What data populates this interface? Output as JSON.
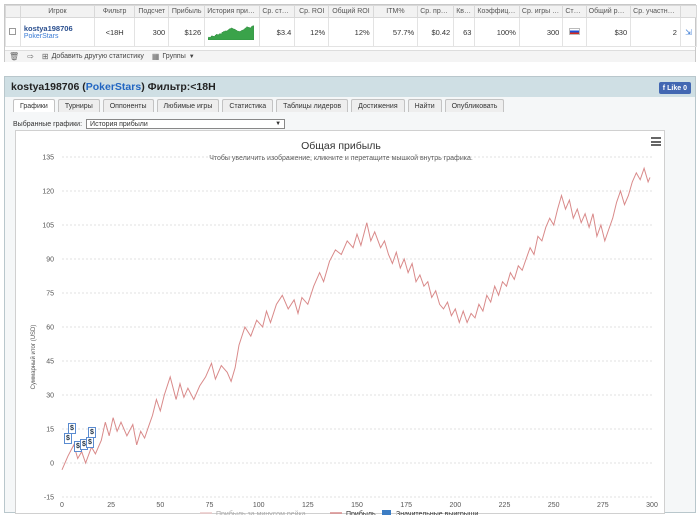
{
  "stats_table": {
    "headers": [
      "",
      "Игрок",
      "Фильтр",
      "Подсчет",
      "Прибыль",
      "История прибыли",
      "Ср. ставка",
      "Ср. ROI",
      "Общий ROI",
      "ITM%",
      "Ср. прибыль",
      "Квалиф.",
      "Коэффициент",
      "Ср. игры / день",
      "Страна",
      "Общий рейк",
      "Ср. участники",
      ""
    ],
    "row": {
      "player_name": "kostya198706",
      "site": "PokerStars",
      "filter": "<18H",
      "count": "300",
      "profit": "$126",
      "avg_stake": "$3.4",
      "avg_roi": "12%",
      "total_roi": "12%",
      "itm": "57.7%",
      "avg_profit": "$0.42",
      "qualif": "63",
      "coefficient": "100%",
      "avg_games": "300",
      "country": "RU",
      "total_rake": "$30",
      "avg_participants": "2"
    },
    "toolbar": {
      "add_stats_label": "Добавить другую статистику",
      "groups_label": "Группы"
    }
  },
  "player_panel": {
    "player_name": "kostya198706",
    "site": "PokerStars",
    "filter_label": "Фильтр:<18H",
    "like_label": "Like 0",
    "tabs": [
      "Графики",
      "Турниры",
      "Оппоненты",
      "Любимые игры",
      "Статистика",
      "Таблицы лидеров",
      "Достижения",
      "Найти",
      "Опубликовать"
    ],
    "active_tab": 0,
    "selected_graphs_label": "Выбранные графики:",
    "selected_graph_value": "История прибыли"
  },
  "chart_data": {
    "type": "line",
    "title": "Общая прибыль",
    "subtitle": "Чтобы увеличить изображение, кликните и перетащите мышкой внутрь графика.",
    "ylabel": "Суммарный итог (USD)",
    "xlim": [
      0,
      300
    ],
    "ylim": [
      -15,
      135
    ],
    "x_ticks": [
      0,
      25,
      50,
      75,
      100,
      125,
      150,
      175,
      200,
      225,
      250,
      275,
      300
    ],
    "y_ticks": [
      -15,
      0,
      15,
      30,
      45,
      60,
      75,
      90,
      105,
      120,
      135
    ],
    "grid": true,
    "series": [
      {
        "name": "Прибыль",
        "color": "#d98a8a",
        "points": [
          [
            0,
            -3
          ],
          [
            3,
            3
          ],
          [
            6,
            8
          ],
          [
            8,
            2
          ],
          [
            10,
            5
          ],
          [
            12,
            0
          ],
          [
            15,
            7
          ],
          [
            17,
            4
          ],
          [
            20,
            10
          ],
          [
            22,
            18
          ],
          [
            24,
            12
          ],
          [
            26,
            20
          ],
          [
            28,
            14
          ],
          [
            30,
            18
          ],
          [
            33,
            12
          ],
          [
            36,
            17
          ],
          [
            38,
            8
          ],
          [
            40,
            14
          ],
          [
            42,
            11
          ],
          [
            44,
            16
          ],
          [
            46,
            21
          ],
          [
            48,
            28
          ],
          [
            50,
            23
          ],
          [
            52,
            30
          ],
          [
            55,
            38
          ],
          [
            58,
            28
          ],
          [
            60,
            35
          ],
          [
            62,
            29
          ],
          [
            64,
            33
          ],
          [
            67,
            28
          ],
          [
            70,
            34
          ],
          [
            73,
            38
          ],
          [
            76,
            44
          ],
          [
            78,
            37
          ],
          [
            81,
            43
          ],
          [
            84,
            40
          ],
          [
            86,
            36
          ],
          [
            88,
            42
          ],
          [
            90,
            52
          ],
          [
            93,
            60
          ],
          [
            96,
            56
          ],
          [
            99,
            63
          ],
          [
            102,
            60
          ],
          [
            104,
            67
          ],
          [
            106,
            62
          ],
          [
            109,
            70
          ],
          [
            112,
            74
          ],
          [
            115,
            68
          ],
          [
            118,
            72
          ],
          [
            120,
            66
          ],
          [
            122,
            73
          ],
          [
            125,
            70
          ],
          [
            128,
            78
          ],
          [
            131,
            84
          ],
          [
            133,
            80
          ],
          [
            136,
            89
          ],
          [
            139,
            94
          ],
          [
            142,
            92
          ],
          [
            145,
            98
          ],
          [
            148,
            95
          ],
          [
            150,
            101
          ],
          [
            152,
            96
          ],
          [
            155,
            106
          ],
          [
            157,
            98
          ],
          [
            159,
            102
          ],
          [
            162,
            95
          ],
          [
            164,
            98
          ],
          [
            166,
            92
          ],
          [
            168,
            88
          ],
          [
            170,
            93
          ],
          [
            172,
            86
          ],
          [
            174,
            90
          ],
          [
            176,
            84
          ],
          [
            178,
            88
          ],
          [
            180,
            80
          ],
          [
            182,
            83
          ],
          [
            184,
            78
          ],
          [
            186,
            80
          ],
          [
            188,
            73
          ],
          [
            190,
            76
          ],
          [
            192,
            70
          ],
          [
            194,
            68
          ],
          [
            196,
            71
          ],
          [
            198,
            65
          ],
          [
            200,
            68
          ],
          [
            202,
            62
          ],
          [
            204,
            67
          ],
          [
            206,
            62
          ],
          [
            208,
            66
          ],
          [
            210,
            64
          ],
          [
            212,
            70
          ],
          [
            214,
            67
          ],
          [
            216,
            74
          ],
          [
            218,
            71
          ],
          [
            220,
            78
          ],
          [
            222,
            74
          ],
          [
            224,
            80
          ],
          [
            226,
            78
          ],
          [
            228,
            84
          ],
          [
            230,
            81
          ],
          [
            232,
            87
          ],
          [
            234,
            85
          ],
          [
            236,
            90
          ],
          [
            238,
            95
          ],
          [
            240,
            92
          ],
          [
            242,
            100
          ],
          [
            244,
            98
          ],
          [
            246,
            104
          ],
          [
            248,
            108
          ],
          [
            250,
            105
          ],
          [
            252,
            112
          ],
          [
            254,
            118
          ],
          [
            256,
            112
          ],
          [
            258,
            116
          ],
          [
            260,
            108
          ],
          [
            262,
            112
          ],
          [
            264,
            106
          ],
          [
            266,
            110
          ],
          [
            268,
            104
          ],
          [
            270,
            110
          ],
          [
            272,
            100
          ],
          [
            274,
            105
          ],
          [
            276,
            98
          ],
          [
            278,
            103
          ],
          [
            280,
            108
          ],
          [
            282,
            115
          ],
          [
            284,
            120
          ],
          [
            286,
            114
          ],
          [
            288,
            118
          ],
          [
            290,
            124
          ],
          [
            292,
            128
          ],
          [
            294,
            125
          ],
          [
            296,
            130
          ],
          [
            298,
            124
          ],
          [
            299,
            126
          ]
        ]
      }
    ],
    "legend": {
      "placement": "bottom-center",
      "entries": [
        "Прибыль за минусом рейка",
        "Прибыль",
        "Значительные выигрыши"
      ]
    },
    "annotations": {
      "cash_markers": [
        "$",
        "$",
        "$",
        "$",
        "$",
        "$"
      ]
    }
  },
  "colors": {
    "panel_header": "#cfdfe4",
    "profit_line": "#d98a8a",
    "link": "#2266c2",
    "facebook": "#4267b2"
  }
}
